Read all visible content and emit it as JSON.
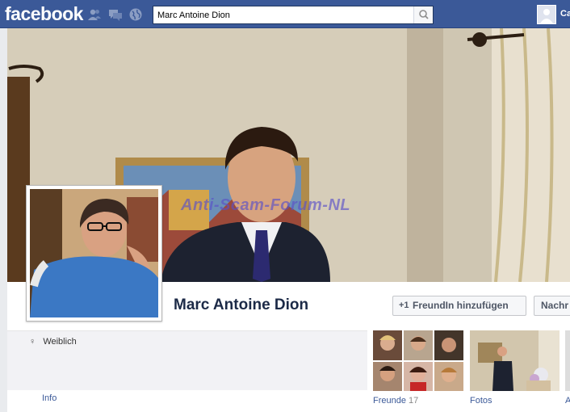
{
  "topbar": {
    "logo": "facebook",
    "search_value": "Marc Antoine Dion",
    "user_name_partial": "Ca"
  },
  "cover": {
    "watermark": "Anti-Scam-Forum-NL"
  },
  "profile": {
    "name": "Marc Antoine Dion",
    "add_friend_label": "FreundIn hinzufügen",
    "add_friend_icon": "+1",
    "message_label": "Nachr"
  },
  "info": {
    "gender": "Weiblich",
    "gender_symbol": "♀",
    "info_link": "Info"
  },
  "tiles": {
    "friends_label": "Freunde",
    "friends_count": "17",
    "photos_label": "Fotos",
    "more_label_partial": "A"
  },
  "colors": {
    "brand": "#3b5998",
    "name": "#1c2a47",
    "info_bg": "#f2f2f5"
  },
  "icons": {
    "jewels": [
      "friend-requests-icon",
      "messages-icon",
      "notifications-globe-icon"
    ],
    "search": "search-icon"
  }
}
